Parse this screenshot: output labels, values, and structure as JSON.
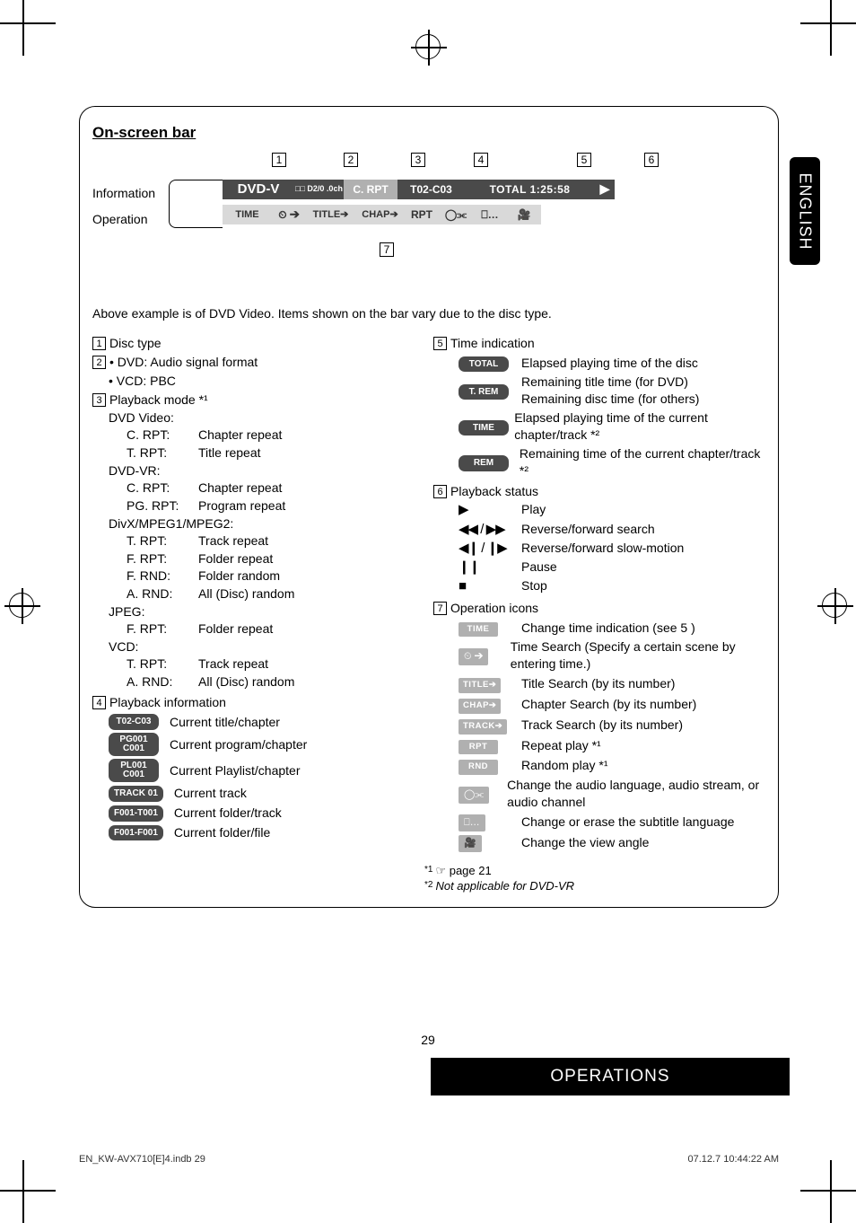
{
  "page_number": "29",
  "side_tab": "ENGLISH",
  "bottom_band": "OPERATIONS",
  "footer_left": "EN_KW-AVX710[E]4.indb   29",
  "footer_right": "07.12.7   10:44:22 AM",
  "box": {
    "title": "On-screen bar",
    "markers": {
      "m1": "1",
      "m2": "2",
      "m3": "3",
      "m4": "4",
      "m5": "5",
      "m6": "6",
      "m7": "7"
    },
    "left_labels": {
      "info": "Information",
      "op": "Operation"
    },
    "info_bar": {
      "dvd_v": "DVD-V",
      "dolby_line1": "□□ D",
      "dolby_line2": "2/0 .0ch",
      "crpt": "C. RPT",
      "tc": "T02-C03",
      "total": "TOTAL  1:25:58",
      "tri": "▶"
    },
    "op_bar": {
      "time": "TIME",
      "clock": "⏲ ➔",
      "title": "TITLE➔",
      "chap": "CHAP➔",
      "rpt": "RPT",
      "aud": "◯⫘",
      "sub": "⎕…",
      "angle": "🎥"
    },
    "note": "Above example is of DVD Video. Items shown on the bar vary due to the disc type.",
    "left_col": {
      "i1": "Disc type",
      "i2_a": "• DVD: Audio signal format",
      "i2_b": "• VCD: PBC",
      "i3": "Playback mode *¹",
      "groups": [
        {
          "head": "DVD Video:",
          "defs": [
            {
              "k": "C. RPT:",
              "v": "Chapter repeat"
            },
            {
              "k": "T. RPT:",
              "v": "Title repeat"
            }
          ]
        },
        {
          "head": "DVD-VR:",
          "defs": [
            {
              "k": "C. RPT:",
              "v": "Chapter repeat"
            },
            {
              "k": "PG. RPT:",
              "v": "Program repeat"
            }
          ]
        },
        {
          "head": "DivX/MPEG1/MPEG2:",
          "defs": [
            {
              "k": "T. RPT:",
              "v": "Track repeat"
            },
            {
              "k": "F. RPT:",
              "v": "Folder repeat"
            },
            {
              "k": "F. RND:",
              "v": "Folder random"
            },
            {
              "k": "A. RND:",
              "v": "All (Disc) random"
            }
          ]
        },
        {
          "head": "JPEG:",
          "defs": [
            {
              "k": "F. RPT:",
              "v": "Folder repeat"
            }
          ]
        },
        {
          "head": "VCD:",
          "defs": [
            {
              "k": "T. RPT:",
              "v": "Track repeat"
            },
            {
              "k": "A. RND:",
              "v": "All (Disc) random"
            }
          ]
        }
      ],
      "i4": "Playback information",
      "pi": [
        {
          "chip": "T02-C03",
          "lab": "Current title/chapter"
        },
        {
          "chip": "PG001\nC001",
          "lab": "Current program/chapter",
          "big": true
        },
        {
          "chip": "PL001\nC001",
          "lab": "Current Playlist/chapter",
          "big": true
        },
        {
          "chip": "TRACK 01",
          "lab": "Current track"
        },
        {
          "chip": "F001-T001",
          "lab": "Current folder/track"
        },
        {
          "chip": "F001-F001",
          "lab": "Current folder/file"
        }
      ]
    },
    "right_col": {
      "i5": "Time indication",
      "time": [
        {
          "chip": "TOTAL",
          "lab": "Elapsed playing time of the disc"
        },
        {
          "chip": "T. REM",
          "lab": "Remaining title time (for DVD)\nRemaining disc time (for others)"
        },
        {
          "chip": "TIME",
          "lab": "Elapsed playing time of the current chapter/track *²"
        },
        {
          "chip": "REM",
          "lab": "Remaining time of the current chapter/track *²"
        }
      ],
      "i6": "Playback status",
      "status": [
        {
          "ic": "▶",
          "lab": "Play"
        },
        {
          "ic": "◀◀ / ▶▶",
          "lab": "Reverse/forward search"
        },
        {
          "ic": "◀❙ / ❙▶",
          "lab": "Reverse/forward slow-motion"
        },
        {
          "ic": "❙❙",
          "lab": "Pause"
        },
        {
          "ic": "■",
          "lab": "Stop"
        }
      ],
      "i7": "Operation icons",
      "ops": [
        {
          "ic": "TIME",
          "flat": true,
          "lab": "Change time indication (see  5 )"
        },
        {
          "ic": "⏲ ➔",
          "mini": true,
          "lab": "Time Search (Specify a certain scene by entering time.)"
        },
        {
          "ic": "TITLE➔",
          "flat": true,
          "lab": "Title Search (by its number)"
        },
        {
          "ic": "CHAP➔",
          "flat": true,
          "lab": "Chapter Search (by its number)"
        },
        {
          "ic": "TRACK➔",
          "flat": true,
          "lab": "Track Search (by its number)"
        },
        {
          "ic": "RPT",
          "flat": true,
          "lab": "Repeat play *¹"
        },
        {
          "ic": "RND",
          "flat": true,
          "lab": "Random play *¹"
        },
        {
          "ic": "◯⫘",
          "mini": true,
          "lab": "Change the audio language, audio stream, or audio channel"
        },
        {
          "ic": "⎕…",
          "mini": true,
          "lab": "Change or erase the subtitle language"
        },
        {
          "ic": "🎥",
          "mini": true,
          "lab": "Change the view angle"
        }
      ]
    },
    "footnotes": {
      "f1_sup": "*1",
      "f1": "☞ page 21",
      "f2_sup": "*2",
      "f2": "Not applicable for DVD-VR"
    }
  }
}
